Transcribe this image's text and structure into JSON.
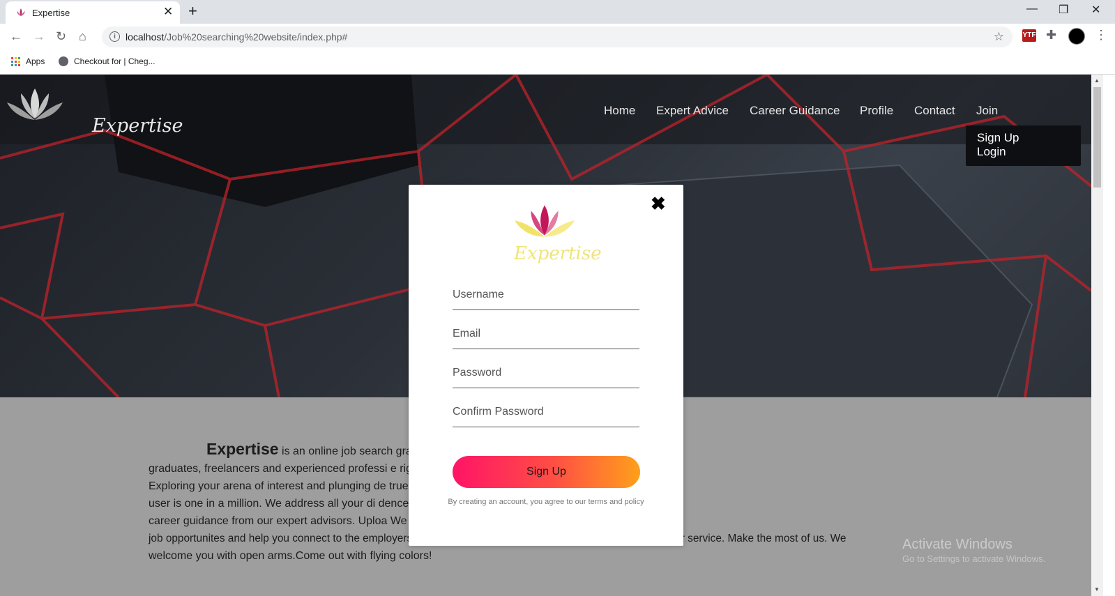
{
  "browser": {
    "tab_title": "Expertise",
    "url_host": "localhost",
    "url_path": "/Job%20searching%20website/index.php#",
    "ext1_label": "YTF",
    "bookmarks": [
      {
        "label": "Apps"
      },
      {
        "label": "Checkout for | Cheg..."
      }
    ]
  },
  "site": {
    "logo_text": "Expertise",
    "nav": [
      "Home",
      "Expert Advice",
      "Career Guidance",
      "Profile",
      "Contact",
      "Join"
    ],
    "join_menu": [
      "Sign Up",
      "Login"
    ]
  },
  "modal": {
    "logo_text": "Expertise",
    "fields": {
      "username": "Username",
      "email": "Email",
      "password": "Password",
      "confirm": "Confirm Password"
    },
    "button": "Sign Up",
    "terms": "By creating an account, you agree to our terms and policy"
  },
  "content": {
    "brand": "Expertise",
    "lines": [
      "is an online job search graduated job-seekers. We endeavour to help the",
      "graduates, freelancers and experienced professi e right job with the right expertise and the right pay.",
      "Exploring your arena of interest and plunging de true to one of a million. At Expertise, every single",
      "user is one in a million. We address all your di dence by providing you with the most appropriate",
      "career guidance from our expert advisors. Uploa We flood your personal page with the most relevant",
      "job opportunites and help you connect to the employers. We are happy to help you. Feel free to acknowledge our service. Make the most of us. We",
      "welcome you with open arms.Come out with flying colors!"
    ],
    "watermark": "Activate Windows",
    "watermark_sub": "Go to Settings to activate Windows."
  },
  "colors": {
    "button_start": "#ff1466",
    "button_end": "#ffa01a",
    "hero_lines": "#c0222a"
  }
}
